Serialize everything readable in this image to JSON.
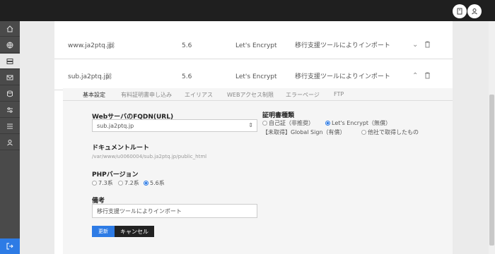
{
  "topbar": {
    "icons": [
      "bookmark-icon",
      "user-icon"
    ]
  },
  "sidebar": {
    "items": [
      "home-icon",
      "globe-icon",
      "server-icon",
      "mail-icon",
      "database-icon",
      "settings-icon",
      "list-icon",
      "user-icon"
    ],
    "active_index": 2,
    "exit_icon": "logout-icon"
  },
  "rows": [
    {
      "domain": "www.ja2ptq.jp",
      "php": "5.6",
      "ssl": "Let's Encrypt",
      "note": "移行支援ツールによりインポート",
      "expanded": false
    },
    {
      "domain": "sub.ja2ptq.jp",
      "php": "5.6",
      "ssl": "Let's Encrypt",
      "note": "移行支援ツールによりインポート",
      "expanded": true
    }
  ],
  "tabs": [
    "基本設定",
    "有料証明書申し込み",
    "エイリアス",
    "WEBアクセス制限",
    "エラーページ",
    "FTP"
  ],
  "active_tab": 0,
  "form": {
    "fqdn_label": "WebサーバのFQDN(URL)",
    "fqdn_value": "sub.ja2ptq.jp",
    "cert_label": "証明書種類",
    "cert_options": [
      "自己証（非推奨）",
      "Let's Encrypt（無償）",
      "【未取得】Global Sign（有償）",
      "他社で取得したもの"
    ],
    "cert_selected": 1,
    "docroot_label": "ドキュメントルート",
    "docroot_value": "/var/www/u0060004/sub.ja2ptq.jp/public_html",
    "php_label": "PHPバージョン",
    "php_options": [
      "7.3系",
      "7.2系",
      "5.6系"
    ],
    "php_selected": 2,
    "remarks_label": "備考",
    "remarks_value": "移行支援ツールによりインポート",
    "update_button": "更新",
    "cancel_button": "キャンセル"
  },
  "colors": {
    "accent": "#2d7be5",
    "topbar": "#1f1f1f",
    "sidebar": "#4a4a4a"
  }
}
